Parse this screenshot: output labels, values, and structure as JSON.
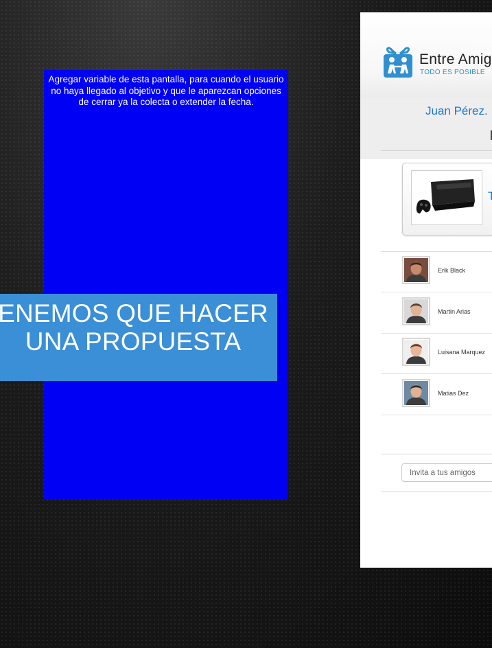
{
  "note": {
    "text": "Agregar variable de esta pantalla, para cuando el usuario no haya llegado al objetivo y que le aparezcan opciones de cerrar ya la colecta o extender la fecha."
  },
  "banner": {
    "line1": "ENEMOS QUE HACER",
    "line2": "UNA PROPUESTA"
  },
  "app": {
    "brand_name": "Entre Amig",
    "tagline": "TODO ES POSIBLE",
    "user_name": "Juan Pérez.",
    "product_title": "T",
    "friends": [
      {
        "name": "Erik Black",
        "skin": "#c48b6a",
        "hair": "#3b2216",
        "bg": "#7a4c3f"
      },
      {
        "name": "Martin Arias",
        "skin": "#e2b497",
        "hair": "#5a4030",
        "bg": "#d8d8d8"
      },
      {
        "name": "Luisana Marquez",
        "skin": "#e7b89a",
        "hair": "#6e3a1f",
        "bg": "#efefef"
      },
      {
        "name": "Matias Dez",
        "skin": "#e0b192",
        "hair": "#3a2a20",
        "bg": "#6f8aa3"
      }
    ],
    "invite_placeholder": "Invita a tus amigos"
  },
  "colors": {
    "note_panel": "#0000f5",
    "banner": "#3a8fd6",
    "brand_blue": "#2f8fd0",
    "link_blue": "#1f78c5"
  }
}
